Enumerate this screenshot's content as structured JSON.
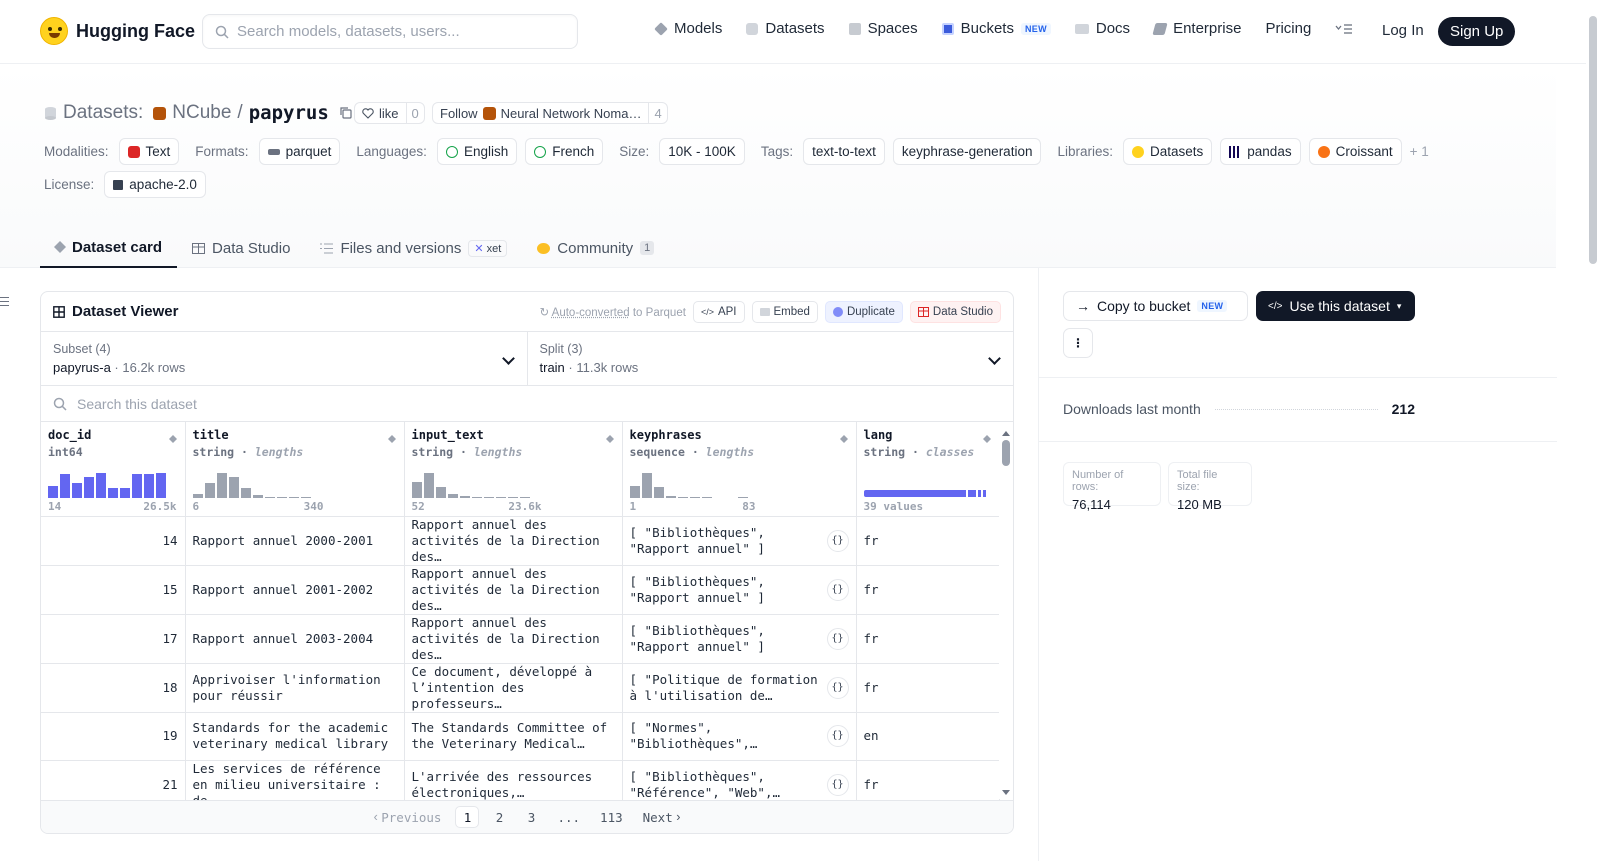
{
  "nav": {
    "brand": "Hugging Face",
    "search_placeholder": "Search models, datasets, users...",
    "links": [
      {
        "label": "Models",
        "icon": "cube-icon"
      },
      {
        "label": "Datasets",
        "icon": "database-icon"
      },
      {
        "label": "Spaces",
        "icon": "grid-icon"
      },
      {
        "label": "Buckets",
        "icon": "bucket-icon",
        "badge": "NEW"
      },
      {
        "label": "Docs",
        "icon": "book-icon"
      },
      {
        "label": "Enterprise",
        "icon": "briefcase-icon"
      },
      {
        "label": "Pricing"
      }
    ],
    "login": "Log In",
    "signup": "Sign Up"
  },
  "repo": {
    "section_label": "Datasets:",
    "org": "NCube",
    "separator": "/",
    "name": "papyrus",
    "like_label": "like",
    "like_count": "0",
    "follow_label": "Follow",
    "follow_org": "Neural Network Noma…",
    "follow_count": "4"
  },
  "meta": {
    "modalities_label": "Modalities:",
    "modalities": [
      "Text"
    ],
    "formats_label": "Formats:",
    "formats": [
      "parquet"
    ],
    "languages_label": "Languages:",
    "languages": [
      "English",
      "French"
    ],
    "size_label": "Size:",
    "size": "10K - 100K",
    "tags_label": "Tags:",
    "tags": [
      "text-to-text",
      "keyphrase-generation"
    ],
    "libraries_label": "Libraries:",
    "libraries": [
      "Datasets",
      "pandas",
      "Croissant"
    ],
    "libraries_more": "+ 1",
    "license_label": "License:",
    "license": "apache-2.0"
  },
  "tabs": [
    {
      "label": "Dataset card",
      "active": true
    },
    {
      "label": "Data Studio"
    },
    {
      "label": "Files and versions",
      "badge": "xet"
    },
    {
      "label": "Community",
      "count": "1"
    }
  ],
  "viewer": {
    "title": "Dataset Viewer",
    "auto_converted_link": "Auto-converted",
    "auto_converted_rest": "to Parquet",
    "api": "API",
    "embed": "Embed",
    "duplicate": "Duplicate",
    "data_studio": "Data Studio",
    "subset_label": "Subset (4)",
    "subset_value": "papyrus-a",
    "subset_rows": "16.2k rows",
    "split_label": "Split (3)",
    "split_value": "train",
    "split_rows": "11.3k rows",
    "search_placeholder": "Search this dataset",
    "columns": [
      {
        "name": "doc_id",
        "type": "int64",
        "stat": "",
        "min": "14",
        "max": "26.5k"
      },
      {
        "name": "title",
        "type": "string",
        "stat": "lengths",
        "min": "6",
        "max": "340"
      },
      {
        "name": "input_text",
        "type": "string",
        "stat": "lengths",
        "min": "52",
        "max": "23.6k"
      },
      {
        "name": "keyphrases",
        "type": "sequence",
        "stat": "lengths",
        "min": "1",
        "max": "83"
      },
      {
        "name": "lang",
        "type": "string",
        "stat": "classes",
        "min": "39 values",
        "max": ""
      }
    ],
    "histograms": {
      "doc_id": [
        0.45,
        0.9,
        0.55,
        0.8,
        0.95,
        0.35,
        0.35,
        0.9,
        0.9,
        0.95
      ],
      "title": [
        0.15,
        0.55,
        0.95,
        0.8,
        0.35,
        0.1,
        0.03,
        0.03,
        0.03,
        0.03
      ],
      "input_text": [
        0.6,
        0.95,
        0.4,
        0.15,
        0.05,
        0.03,
        0.03,
        0.03,
        0.03,
        0.03
      ],
      "keyphrases": [
        0.45,
        0.95,
        0.4,
        0.05,
        0.03,
        0.03,
        0.03,
        0,
        0,
        0.03
      ]
    },
    "rows": [
      {
        "doc_id": "14",
        "title": "Rapport annuel 2000-2001",
        "input_text": "Rapport annuel des activités de la Direction des…",
        "keyphrases": "[ \"Bibliothèques\", \"Rapport annuel\" ]",
        "lang": "fr"
      },
      {
        "doc_id": "15",
        "title": "Rapport annuel 2001-2002",
        "input_text": "Rapport annuel des activités de la Direction des…",
        "keyphrases": "[ \"Bibliothèques\", \"Rapport annuel\" ]",
        "lang": "fr"
      },
      {
        "doc_id": "17",
        "title": "Rapport annuel 2003-2004",
        "input_text": "Rapport annuel des activités de la Direction des…",
        "keyphrases": "[ \"Bibliothèques\", \"Rapport annuel\" ]",
        "lang": "fr"
      },
      {
        "doc_id": "18",
        "title": "Apprivoiser l'information pour réussir",
        "input_text": "Ce document, développé à l’intention des professeurs…",
        "keyphrases": "[ \"Politique de formation à l'utilisation de…",
        "lang": "fr"
      },
      {
        "doc_id": "19",
        "title": "Standards for the academic veterinary medical library",
        "input_text": "The Standards Committee of the Veterinary Medical…",
        "keyphrases": "[ \"Normes\", \"Bibliothèques\",…",
        "lang": "en"
      },
      {
        "doc_id": "21",
        "title": "Les services de référence en milieu universitaire : de…",
        "input_text": "L'arrivée des ressources électroniques,…",
        "keyphrases": "[ \"Bibliothèques\", \"Référence\", \"Web\",…",
        "lang": "fr"
      }
    ],
    "pager": {
      "prev": "Previous",
      "pages": [
        "1",
        "2",
        "3",
        "...",
        "113"
      ],
      "current": "1",
      "next": "Next"
    }
  },
  "sidebar": {
    "copy_to_bucket": "Copy to bucket",
    "copy_badge": "NEW",
    "use_dataset": "Use this dataset",
    "downloads_label": "Downloads last month",
    "downloads_value": "212",
    "rows_label": "Number of rows:",
    "rows_value": "76,114",
    "size_label": "Total file size:",
    "size_value": "120 MB"
  },
  "colors": {
    "hist_blue": "#6366f1",
    "hist_gray": "#9ca3af",
    "brand_yellow": "#ffd21e"
  }
}
